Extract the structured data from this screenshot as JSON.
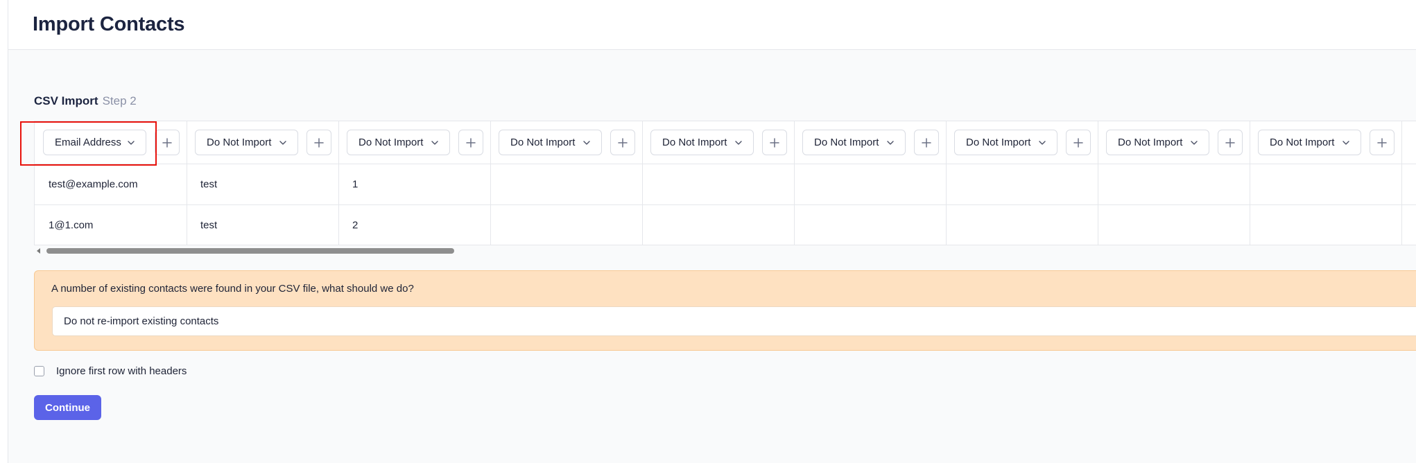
{
  "page": {
    "title": "Import Contacts"
  },
  "section": {
    "title": "CSV Import",
    "step": "Step 2"
  },
  "mapping_table": {
    "columns": [
      {
        "mapping": "Email Address"
      },
      {
        "mapping": "Do Not Import"
      },
      {
        "mapping": "Do Not Import"
      },
      {
        "mapping": "Do Not Import"
      },
      {
        "mapping": "Do Not Import"
      },
      {
        "mapping": "Do Not Import"
      },
      {
        "mapping": "Do Not Import"
      },
      {
        "mapping": "Do Not Import"
      },
      {
        "mapping": "Do Not Import"
      }
    ],
    "rows": [
      [
        "test@example.com",
        "test",
        "1",
        "",
        "",
        "",
        "",
        "",
        ""
      ],
      [
        "1@1.com",
        "test",
        "2",
        "",
        "",
        "",
        "",
        "",
        ""
      ]
    ]
  },
  "existing_contacts": {
    "question": "A number of existing contacts were found in your CSV file, what should we do?",
    "selected_option": "Do not re-import existing contacts"
  },
  "ignore_header": {
    "label": "Ignore first row with headers",
    "checked": false
  },
  "actions": {
    "continue_label": "Continue"
  },
  "colors": {
    "primary": "#5b63e8",
    "warning_bg": "#fee1c1",
    "highlight": "#e8120c"
  },
  "icons": {
    "dropdown": "chevron-down-icon",
    "add": "plus-icon"
  }
}
